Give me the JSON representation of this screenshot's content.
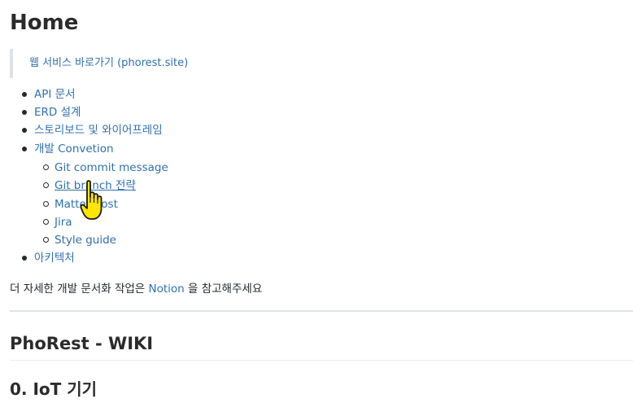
{
  "page": {
    "title": "Home",
    "quote_link": "웹 서비스 바로가기 (phorest.site)"
  },
  "nav": {
    "items": [
      {
        "label": "API 문서"
      },
      {
        "label": "ERD 설계"
      },
      {
        "label": "스토리보드 및 와이어프레임"
      },
      {
        "label": "개발 Convetion"
      }
    ],
    "sub_items": [
      {
        "label": "Git commit message"
      },
      {
        "label": "Git branch 전략"
      },
      {
        "label": "Mattermost"
      },
      {
        "label": "Jira"
      },
      {
        "label": "Style guide"
      }
    ],
    "last_item": {
      "label": "아키텍처"
    }
  },
  "notice": {
    "before": "더 자세한 개발 문서화 작업은 ",
    "link": "Notion",
    "after": " 을 참고해주세요"
  },
  "sections": {
    "wiki_heading": "PhoRest - WIKI",
    "iot_heading": "0. IoT 기기"
  },
  "cursor": {
    "icon": "hand-pointer-icon"
  },
  "colors": {
    "link": "#2f6fb0",
    "text": "#24292e",
    "cursor": "#ffe600"
  }
}
